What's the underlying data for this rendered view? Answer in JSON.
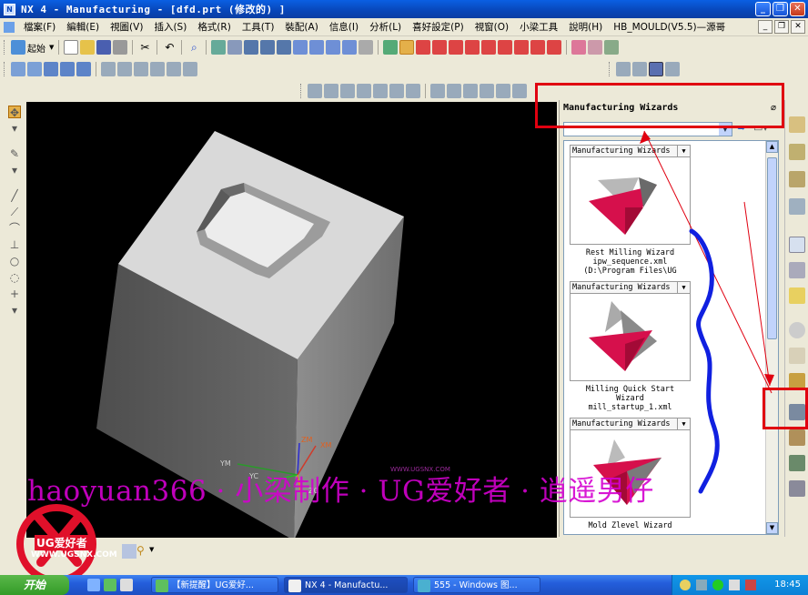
{
  "window": {
    "title": "NX 4 - Manufacturing - [dfd.prt  (修改的) ]",
    "controls": [
      "_",
      "❐",
      "✕"
    ]
  },
  "menu": {
    "items": [
      "檔案(F)",
      "編輯(E)",
      "視圖(V)",
      "插入(S)",
      "格式(R)",
      "工具(T)",
      "裝配(A)",
      "信息(I)",
      "分析(L)",
      "喜好設定(P)",
      "視窗(O)",
      "小梁工具",
      "說明(H)",
      "HB_MOULD(V5.5)—源哥"
    ],
    "right_controls": [
      "_",
      "❐",
      "✕"
    ]
  },
  "toolbar": {
    "start_label": "起始"
  },
  "navigator": {
    "title": "Manufacturing Wizards",
    "combo_value": "",
    "cards": [
      {
        "header": "Manufacturing Wizards",
        "caption_lines": [
          "Rest Milling Wizard",
          "ipw_sequence.xml",
          "(D:\\Program Files\\UG"
        ]
      },
      {
        "header": "Manufacturing Wizards",
        "caption_lines": [
          "Milling Quick Start",
          "Wizard",
          "mill_startup_1.xml"
        ]
      },
      {
        "header": "Manufacturing Wizards",
        "caption_lines": [
          "Mold Zlevel  Wizard"
        ]
      }
    ]
  },
  "viewport": {
    "axis_labels": {
      "zm": "ZM",
      "xm": "XM",
      "ym": "YM",
      "yc": "YC",
      "zc": "ZC"
    },
    "small_watermark": "WWW.UGSNX.COM"
  },
  "watermark_text": "haoyuan366 · 小梁制作 · UG爱好者 · 逍遥男仔",
  "logo": {
    "text": "UG爱好者",
    "url": "WWW.UGSNX.COM"
  },
  "taskbar": {
    "start": "开始",
    "tasks": [
      {
        "label": "【新提醒】UG爱好..."
      },
      {
        "label": "NX 4 - Manufactu..."
      },
      {
        "label": "555 - Windows 图..."
      }
    ],
    "clock": "18:45"
  },
  "colors": {
    "highlight": "#e00010",
    "wizard_icon": "#d6104c",
    "annotation": "#1020e0"
  }
}
